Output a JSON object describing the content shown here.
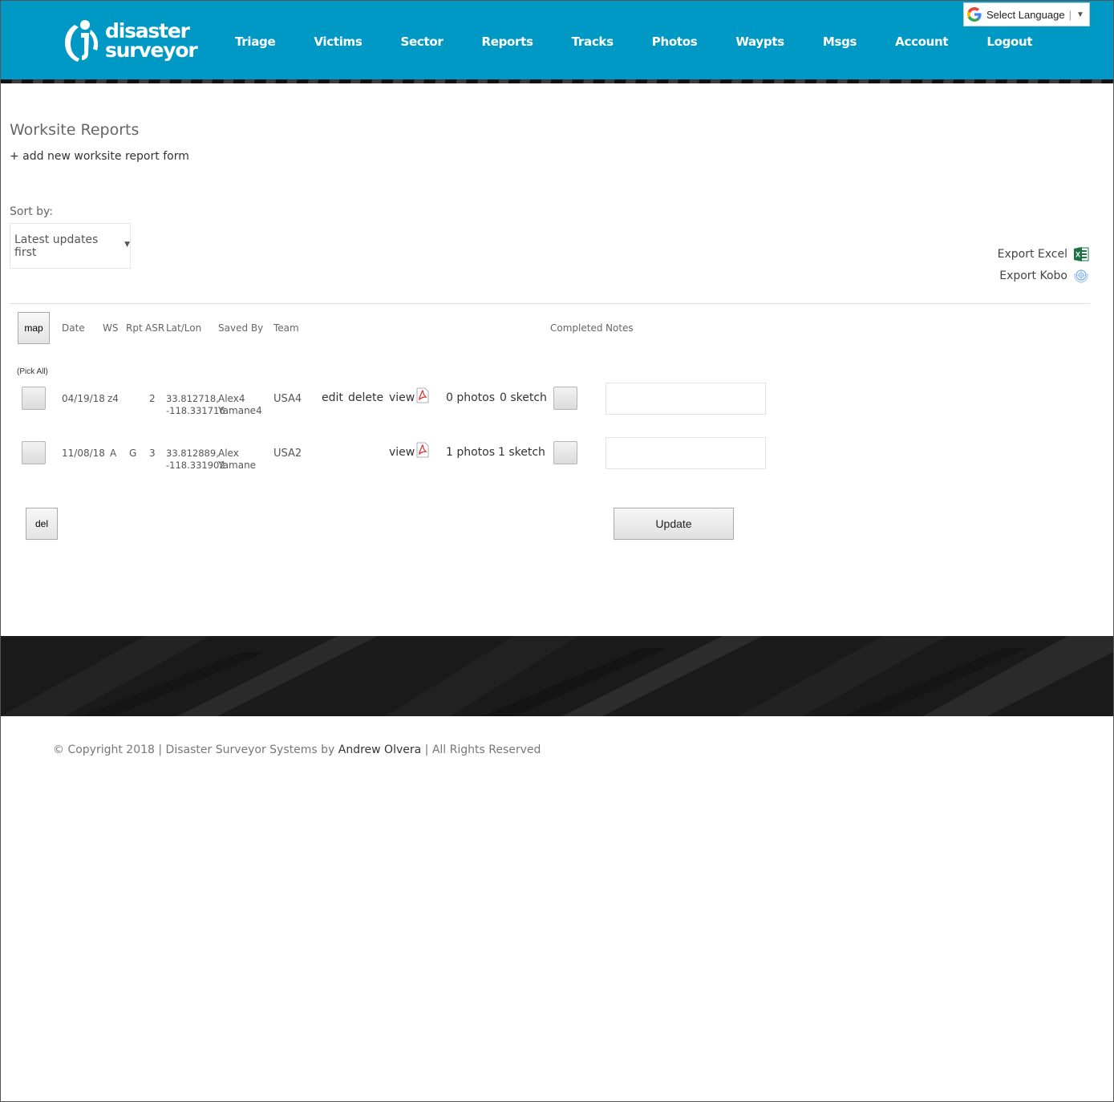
{
  "brand": {
    "line1": "disaster",
    "line2": "surveyor"
  },
  "nav": [
    "Triage",
    "Victims",
    "Sector",
    "Reports",
    "Tracks",
    "Photos",
    "Waypts",
    "Msgs",
    "Account",
    "Logout"
  ],
  "language": {
    "label": "Select Language",
    "icon": "google-g-icon"
  },
  "page": {
    "title": "Worksite Reports",
    "add_link": "+ add new worksite report form",
    "sort_label": "Sort by:",
    "sort_value": "Latest updates first"
  },
  "export": {
    "excel": "Export Excel",
    "kobo": "Export Kobo"
  },
  "table": {
    "map_button": "map",
    "pick_all": "(Pick All)",
    "headers": {
      "date": "Date",
      "ws": "WS",
      "rpt": "Rpt",
      "asr": "ASR",
      "latlon": "Lat/Lon",
      "saved_by": "Saved By",
      "team": "Team",
      "completed": "Completed",
      "notes": "Notes"
    },
    "rows": [
      {
        "date": "04/19/18",
        "ws": "z4",
        "rpt": "",
        "asr": "2",
        "lat": "33.812718,",
        "lon": "-118.331716",
        "saved_by_1": "Alex4",
        "saved_by_2": "Yamane4",
        "team": "USA4",
        "edit": "edit",
        "delete": "delete",
        "view": "view",
        "photos": "0 photos",
        "sketch": "0 sketch",
        "notes": ""
      },
      {
        "date": "11/08/18",
        "ws": "A",
        "rpt": "G",
        "asr": "3",
        "lat": "33.812889,",
        "lon": "-118.331902",
        "saved_by_1": "Alex",
        "saved_by_2": "Yamane",
        "team": "USA2",
        "view": "view",
        "photos": "1 photos",
        "sketch": "1 sketch",
        "notes": ""
      }
    ],
    "del_button": "del",
    "update_button": "Update"
  },
  "footer": {
    "copyright_pre": "© Copyright 2018 | Disaster Surveyor Systems by",
    "author": "Andrew Olvera",
    "copyright_post": "| All Rights Reserved"
  },
  "colors": {
    "header_bg": "#0099c5",
    "footer_bg": "#1a1a1a",
    "excel_green": "#1e7145",
    "pdf_red": "#d9242c"
  }
}
